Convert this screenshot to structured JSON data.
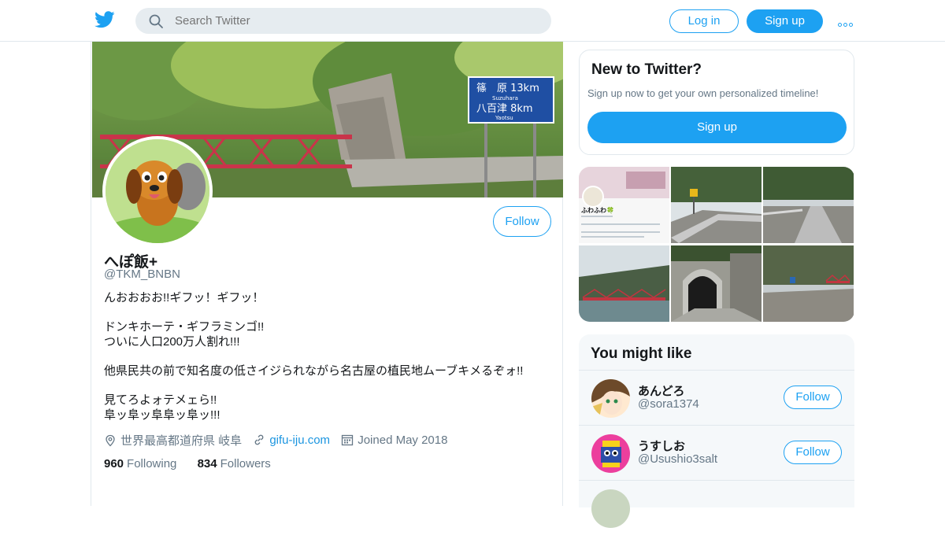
{
  "topbar": {
    "search_placeholder": "Search Twitter",
    "login_label": "Log in",
    "signup_label": "Sign up",
    "brand_color": "#1da1f2"
  },
  "profile": {
    "name": "へぽ飯+",
    "handle": "@TKM_BNBN",
    "follow_label": "Follow",
    "bio": [
      "んおおおお!!ギフッ！ギフッ！",
      "ドンキホーテ・ギフラミンゴ!!\nついに人口200万人割れ!!!",
      "他県民共の前で知名度の低さイジられながら名古屋の植民地ムーブキメるぞォ!!",
      "見てろよォテメェら!!\n阜ッ阜ッ阜阜ッ阜ッ!!!"
    ],
    "location": "世界最高都道府県 岐阜",
    "link": "gifu-iju.com",
    "joined": "Joined May 2018",
    "following_count": "960",
    "following_label": "Following",
    "followers_count": "834",
    "followers_label": "Followers",
    "banner_sign": {
      "line1": "篠　原 13km",
      "line1_romaji": "Suzuhara",
      "line2": "八百津 8km",
      "line2_romaji": "Yaotsu"
    }
  },
  "sidebar": {
    "new_title": "New to Twitter?",
    "new_desc": "Sign up now to get your own personalized timeline!",
    "signup_label": "Sign up",
    "media_thumb1_text": "ふわふわ🍀",
    "you_might_like_title": "You might like",
    "suggestions": [
      {
        "name": "あんどろ",
        "handle": "@sora1374",
        "follow_label": "Follow"
      },
      {
        "name": "うすしお",
        "handle": "@Usushio3salt",
        "follow_label": "Follow"
      }
    ]
  }
}
